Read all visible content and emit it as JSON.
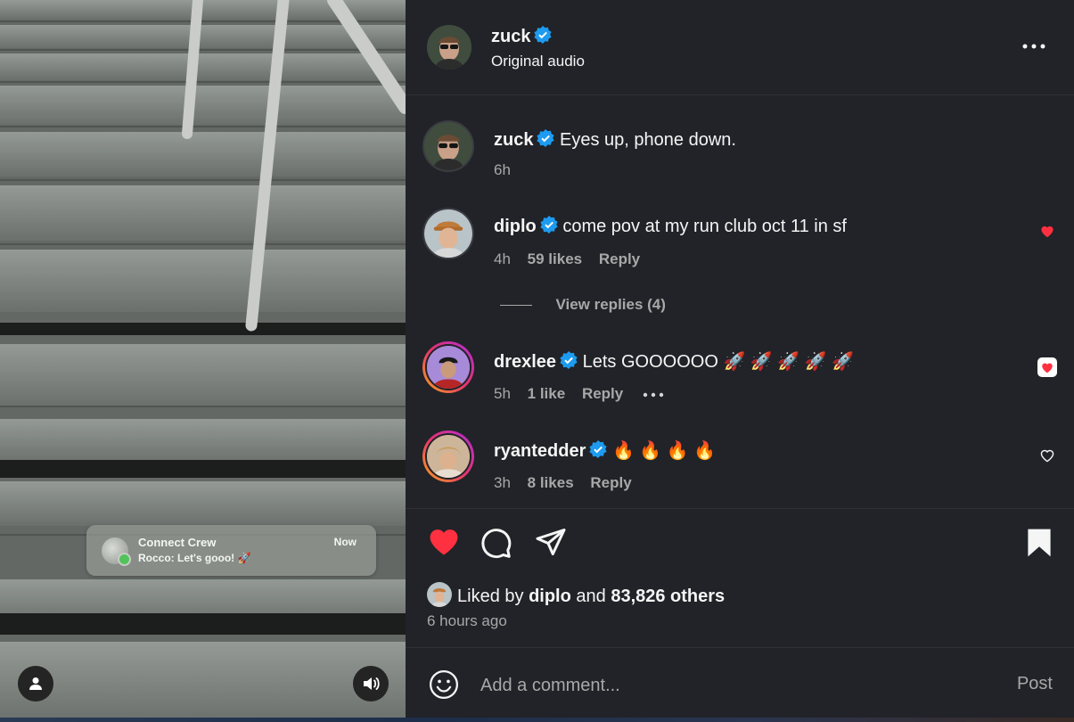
{
  "media": {
    "notification": {
      "title": "Connect Crew",
      "message": "Rocco: Let's gooo! 🚀",
      "time": "Now"
    }
  },
  "post": {
    "author": "zuck",
    "audio": "Original audio"
  },
  "comments": [
    {
      "username": "zuck",
      "text": "Eyes up, phone down.",
      "time": "6h",
      "likes": "",
      "reply": ""
    },
    {
      "username": "diplo",
      "text": "come pov at my run club oct 11 in sf",
      "time": "4h",
      "likes": "59 likes",
      "reply": "Reply",
      "liked": true
    },
    {
      "username": "drexlee",
      "text": "Lets GOOOOOO 🚀 🚀 🚀 🚀 🚀",
      "time": "5h",
      "likes": "1 like",
      "reply": "Reply",
      "liked": true
    },
    {
      "username": "ryantedder",
      "text": "🔥 🔥 🔥 🔥",
      "time": "3h",
      "likes": "8 likes",
      "reply": "Reply",
      "liked": false
    }
  ],
  "view_replies": "View replies (4)",
  "likes_summary": {
    "prefix": "Liked by",
    "user": "diplo",
    "and": "and",
    "others": "83,826 others"
  },
  "timestamp": "6 hours ago",
  "compose": {
    "placeholder": "Add a comment...",
    "post_label": "Post"
  },
  "colors": {
    "panel": "#212328",
    "verified": "#1d9bf0",
    "like_red": "#ff3040",
    "muted": "#a8a8a8"
  }
}
